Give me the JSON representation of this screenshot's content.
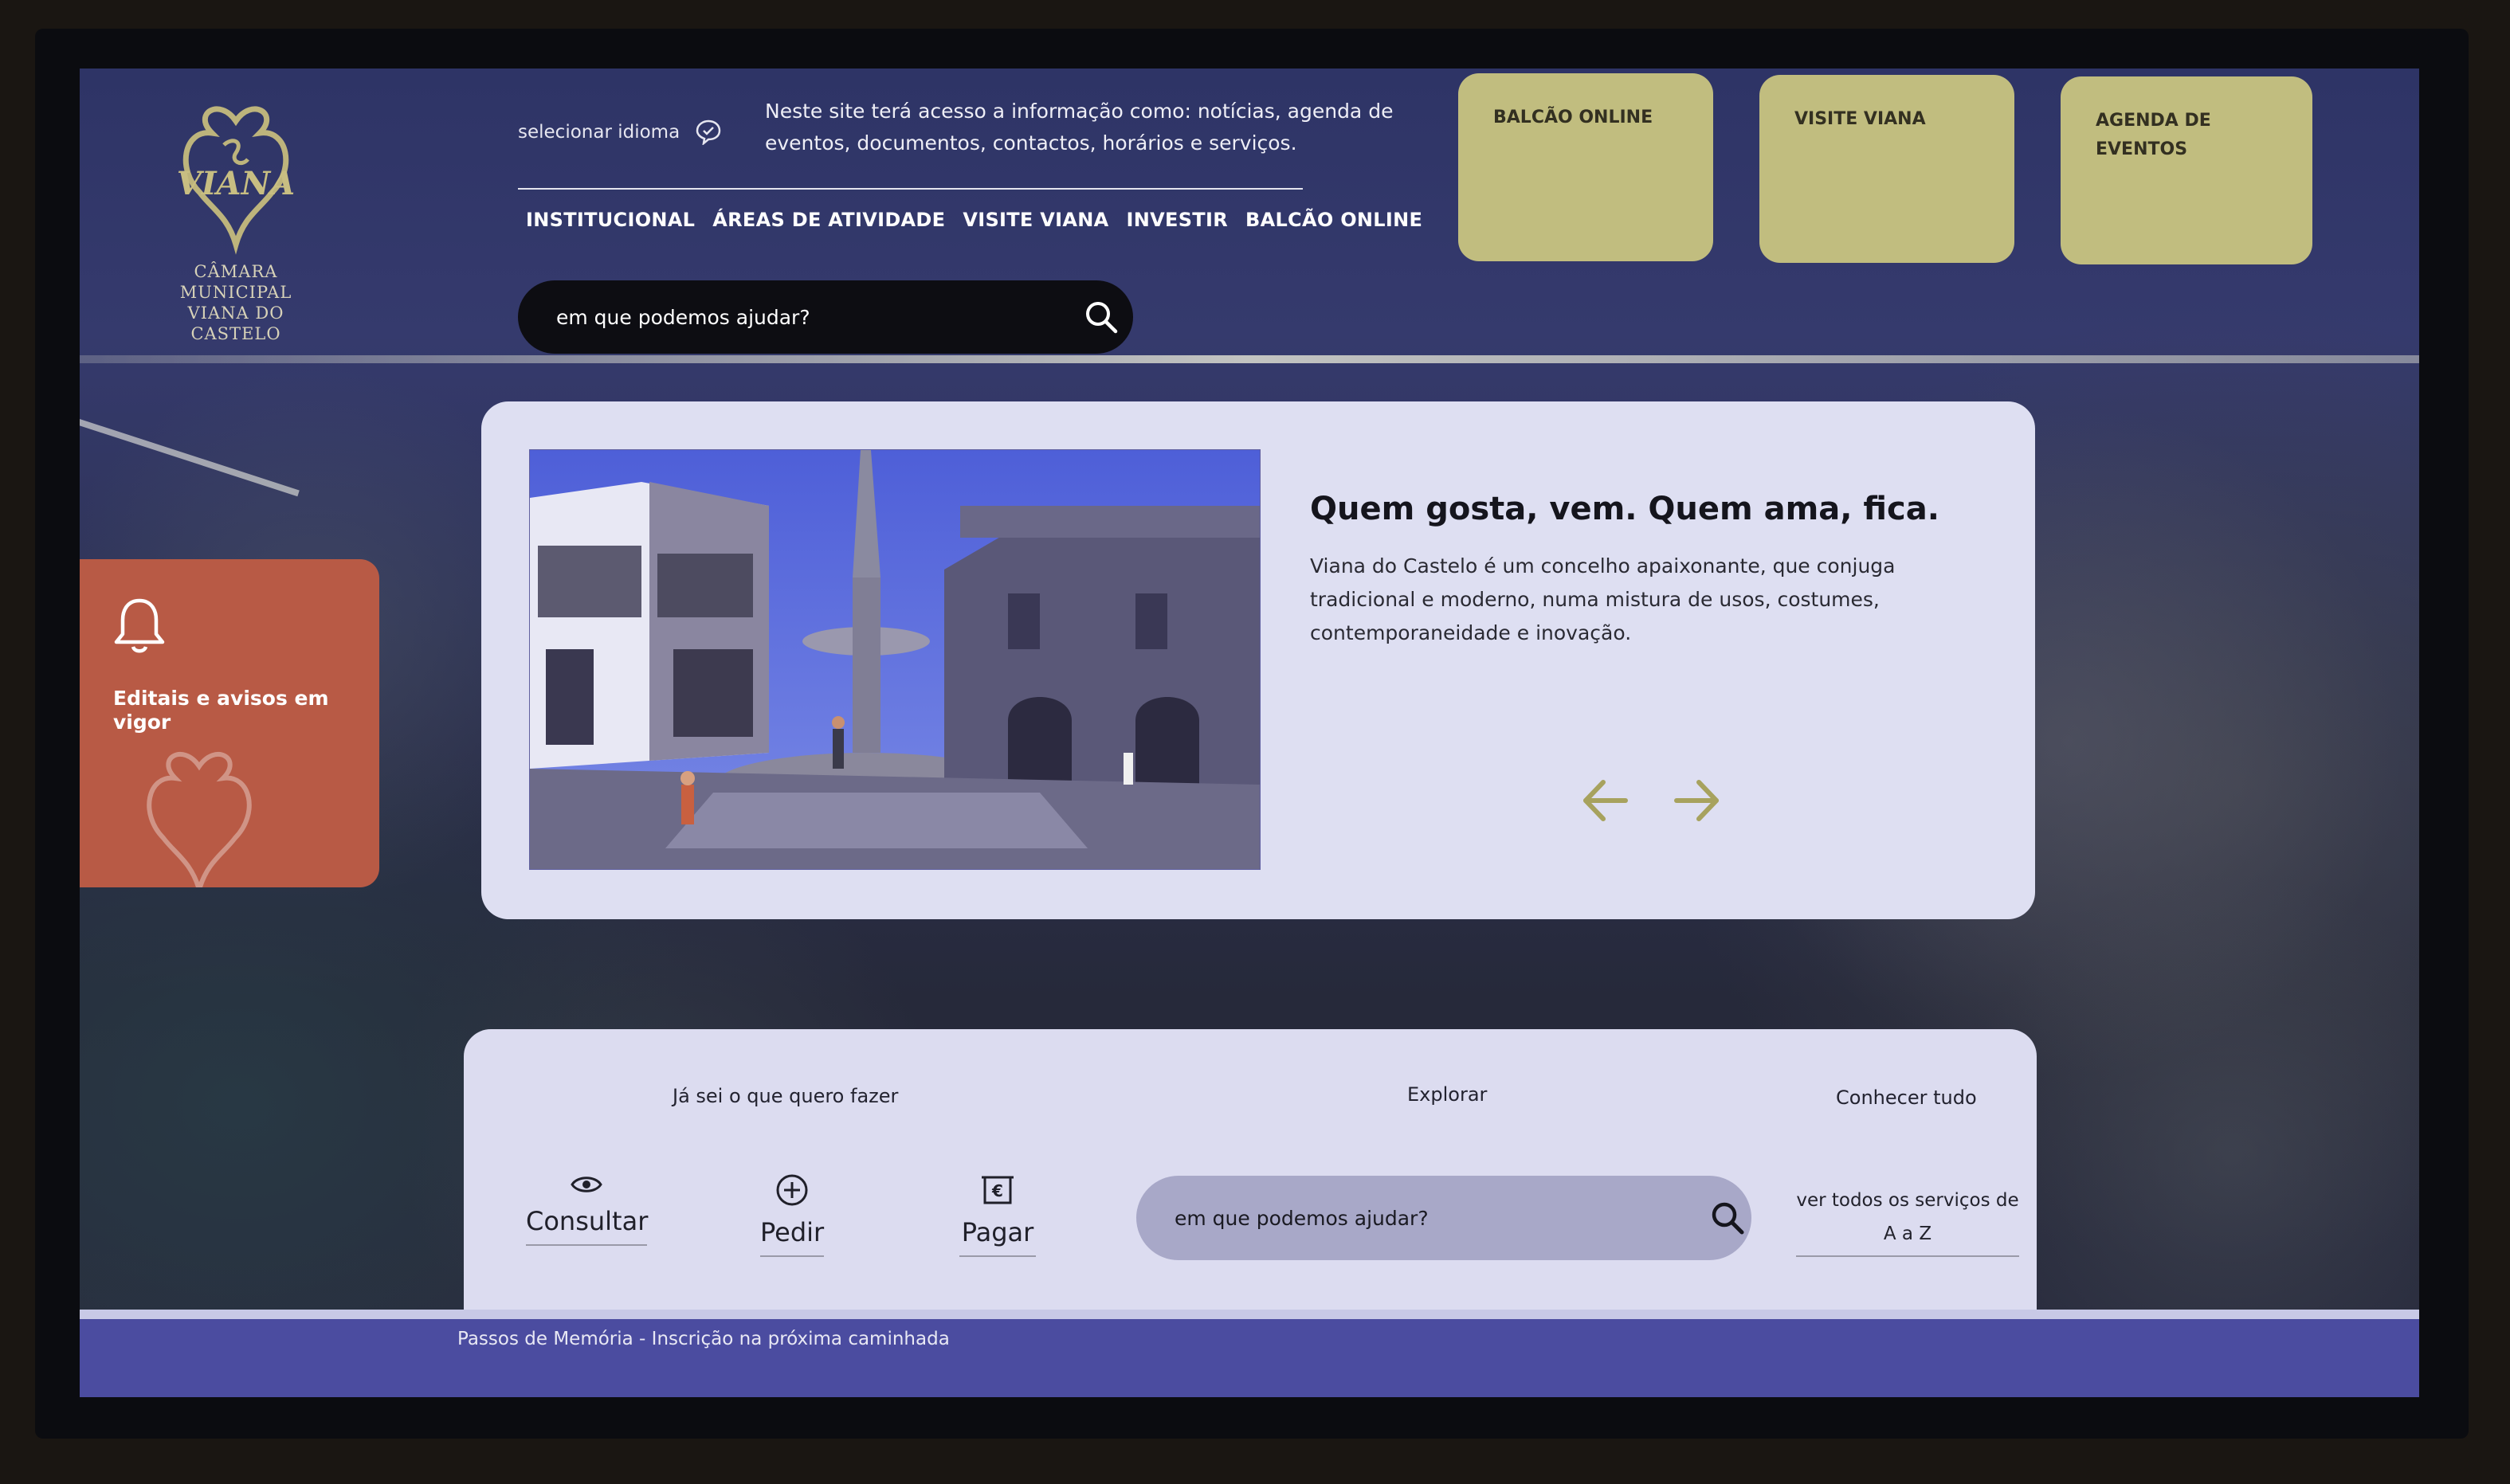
{
  "logo": {
    "mark_text": "VIANA",
    "line1": "CÂMARA MUNICIPAL",
    "line2": "VIANA DO CASTELO"
  },
  "header": {
    "language_label": "selecionar idioma",
    "intro_text": "Neste site terá acesso a informação como: notícias, agenda de eventos, documentos, contactos, horários e serviços.",
    "nav": [
      "INSTITUCIONAL",
      "ÁREAS DE ATIVIDADE",
      "VISITE VIANA",
      "INVESTIR",
      "BALCÃO ONLINE"
    ],
    "search_placeholder": "em que podemos ajudar?"
  },
  "tiles": [
    "BALCÃO ONLINE",
    "VISITE VIANA",
    "AGENDA DE EVENTOS"
  ],
  "alert": {
    "label": "Editais e avisos em vigor"
  },
  "hero": {
    "title": "Quem gosta, vem. Quem ama, fica.",
    "text": "Viana do Castelo é um concelho apaixonante, que conjuga tradicional e moderno, numa mistura de usos, costumes, contemporaneidade e inovação."
  },
  "services": {
    "col1_label": "Já sei o que quero fazer",
    "col2_label": "Explorar",
    "col3_label": "Conhecer tudo",
    "actions": [
      "Consultar",
      "Pedir",
      "Pagar"
    ],
    "search_placeholder": "em que podemos ajudar?",
    "az_link": "ver todos os serviços de A a Z"
  },
  "ticker": {
    "text": "Passos de Memória - Inscrição na próxima caminhada"
  },
  "colors": {
    "tile": "#c1bd7f",
    "alert": "#b85a45",
    "ticker": "#4b4ca0",
    "arrow": "#a7a25e"
  }
}
